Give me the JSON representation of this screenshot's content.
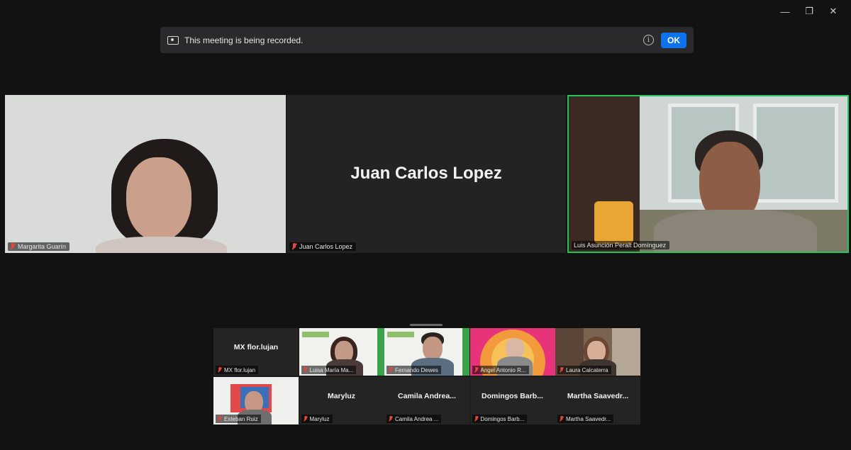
{
  "window": {
    "minimize_glyph": "—",
    "restore_glyph": "❐",
    "close_glyph": "✕"
  },
  "banner": {
    "message": "This meeting is being recorded.",
    "info_glyph": "i",
    "ok_label": "OK"
  },
  "main_tiles": [
    {
      "name": "Margarita Guarín",
      "video": true
    },
    {
      "name": "Juan Carlos Lopez",
      "display_name": "Juan Carlos Lopez",
      "video": false
    },
    {
      "name": "Luis Asunción Peralt Domínguez",
      "video": true,
      "active_speaker": true
    }
  ],
  "gallery": [
    {
      "name": "MX flor.lujan",
      "display_name": "MX flor.lujan",
      "video": false
    },
    {
      "name": "Luisa María Ma...",
      "video": true
    },
    {
      "name": "Fernando Dewes",
      "video": true
    },
    {
      "name": "Angel Antonio R...",
      "video": true
    },
    {
      "name": "Laura Calcaterra",
      "video": true
    },
    {
      "name": "Esteban Ruiz",
      "video": true
    },
    {
      "name": "Maryluz",
      "display_name": "Maryluz",
      "video": false
    },
    {
      "name": "Camila Andrea ...",
      "display_name": "Camila Andrea...",
      "video": false
    },
    {
      "name": "Domingos Barb...",
      "display_name": "Domingos Barb...",
      "video": false
    },
    {
      "name": "Martha Saavedr...",
      "display_name": "Martha Saavedr...",
      "video": false
    }
  ],
  "colors": {
    "background": "#121212",
    "accent_blue": "#0e72ed",
    "active_speaker_border": "#24c45a",
    "muted_mic": "#e8453c"
  }
}
